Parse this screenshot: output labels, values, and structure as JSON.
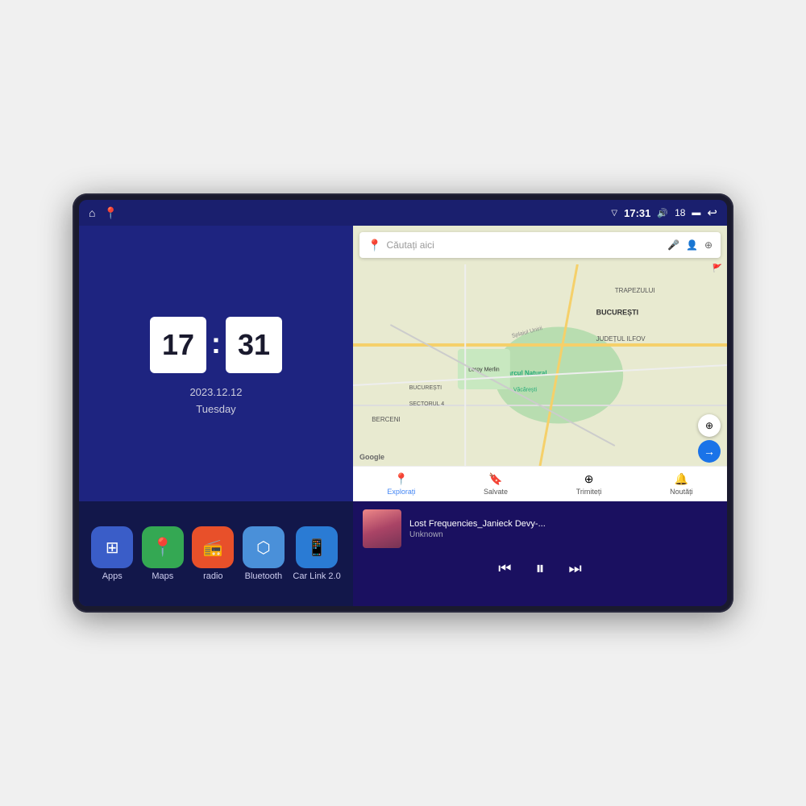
{
  "device": {
    "status_bar": {
      "time": "17:31",
      "signal": "18",
      "home_icon": "⌂",
      "maps_icon": "📍",
      "signal_icon": "▼",
      "volume_icon": "🔊",
      "battery_icon": "▬",
      "back_icon": "↩"
    },
    "clock": {
      "hours": "17",
      "minutes": "31",
      "date": "2023.12.12",
      "day": "Tuesday"
    },
    "map": {
      "search_placeholder": "Căutați aici",
      "nav_items": [
        {
          "label": "Explorați",
          "icon": "📍",
          "active": true
        },
        {
          "label": "Salvate",
          "icon": "🔖",
          "active": false
        },
        {
          "label": "Trimiteți",
          "icon": "⊕",
          "active": false
        },
        {
          "label": "Noutăți",
          "icon": "🔔",
          "active": false
        }
      ],
      "labels": [
        "BUCUREȘTI",
        "JUDEȚUL ILFOV",
        "TRAPEZULUI",
        "BERCENI",
        "Parcul Natural Văcărești",
        "Leroy Merlin",
        "BUCUREȘTI SECTORUL 4"
      ]
    },
    "apps": [
      {
        "label": "Apps",
        "icon": "⊞",
        "bg": "#3a5dc8"
      },
      {
        "label": "Maps",
        "icon": "📍",
        "bg": "#34a853"
      },
      {
        "label": "radio",
        "icon": "📻",
        "bg": "#e8502a"
      },
      {
        "label": "Bluetooth",
        "icon": "🔷",
        "bg": "#4a90d9"
      },
      {
        "label": "Car Link 2.0",
        "icon": "📱",
        "bg": "#2ecc71"
      }
    ],
    "music": {
      "title": "Lost Frequencies_Janieck Devy-...",
      "artist": "Unknown",
      "prev_icon": "⏮",
      "play_icon": "⏸",
      "next_icon": "⏭"
    }
  }
}
